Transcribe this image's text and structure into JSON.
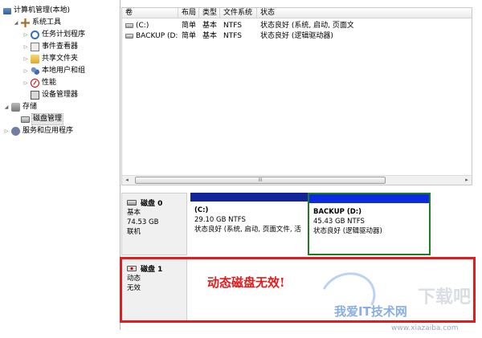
{
  "tree": {
    "items": [
      {
        "label": "计算机管理(本地)",
        "icon": "computer-icon",
        "expander": ""
      },
      {
        "label": "系统工具",
        "icon": "tools-icon",
        "expander": "◢"
      },
      {
        "label": "任务计划程序",
        "icon": "clock-icon",
        "expander": "▷"
      },
      {
        "label": "事件查看器",
        "icon": "event-log-icon",
        "expander": "▷"
      },
      {
        "label": "共享文件夹",
        "icon": "folder-icon",
        "expander": "▷"
      },
      {
        "label": "本地用户和组",
        "icon": "users-icon",
        "expander": "▷"
      },
      {
        "label": "性能",
        "icon": "performance-icon",
        "expander": "▷"
      },
      {
        "label": "设备管理器",
        "icon": "device-icon",
        "expander": ""
      },
      {
        "label": "存储",
        "icon": "storage-icon",
        "expander": "◢"
      },
      {
        "label": "磁盘管理",
        "icon": "disk-icon",
        "expander": ""
      },
      {
        "label": "服务和应用程序",
        "icon": "services-icon",
        "expander": "▷"
      }
    ]
  },
  "volumes": {
    "columns": [
      "卷",
      "布局",
      "类型",
      "文件系统",
      "状态"
    ],
    "rows": [
      {
        "name": "(C:)",
        "layout": "简单",
        "type": "基本",
        "fs": "NTFS",
        "status": "状态良好 (系统, 启动, 页面文("
      },
      {
        "name": "BACKUP (D:)",
        "layout": "简单",
        "type": "基本",
        "fs": "NTFS",
        "status": "状态良好 (逻辑驱动器)"
      }
    ],
    "scroll_left": "◂",
    "scroll_right": "▸",
    "scroll_grip": "III"
  },
  "disks": [
    {
      "name": "磁盘 0",
      "kind": "基本",
      "size": "74.53 GB",
      "state": "联机",
      "partitions": [
        {
          "title": "(C:)",
          "size": "29.10 GB NTFS",
          "status": "状态良好 (系统, 启动, 页面文件, 活"
        },
        {
          "title": "BACKUP (D:)",
          "size": "45.43 GB NTFS",
          "status": "状态良好 (逻辑驱动器)"
        }
      ]
    },
    {
      "name": "磁盘 1",
      "kind": "动态",
      "size": "",
      "state": "无效"
    }
  ],
  "annotation": "动态磁盘无效!",
  "watermark": {
    "line1": "下载吧",
    "line2": "我爱IT技术网",
    "line3": "www.xiazaiba.com"
  },
  "colors": {
    "partition_bar": "#13249a",
    "selected_partition_border": "#1d7d25",
    "annotation_red": "#e31b1b"
  }
}
